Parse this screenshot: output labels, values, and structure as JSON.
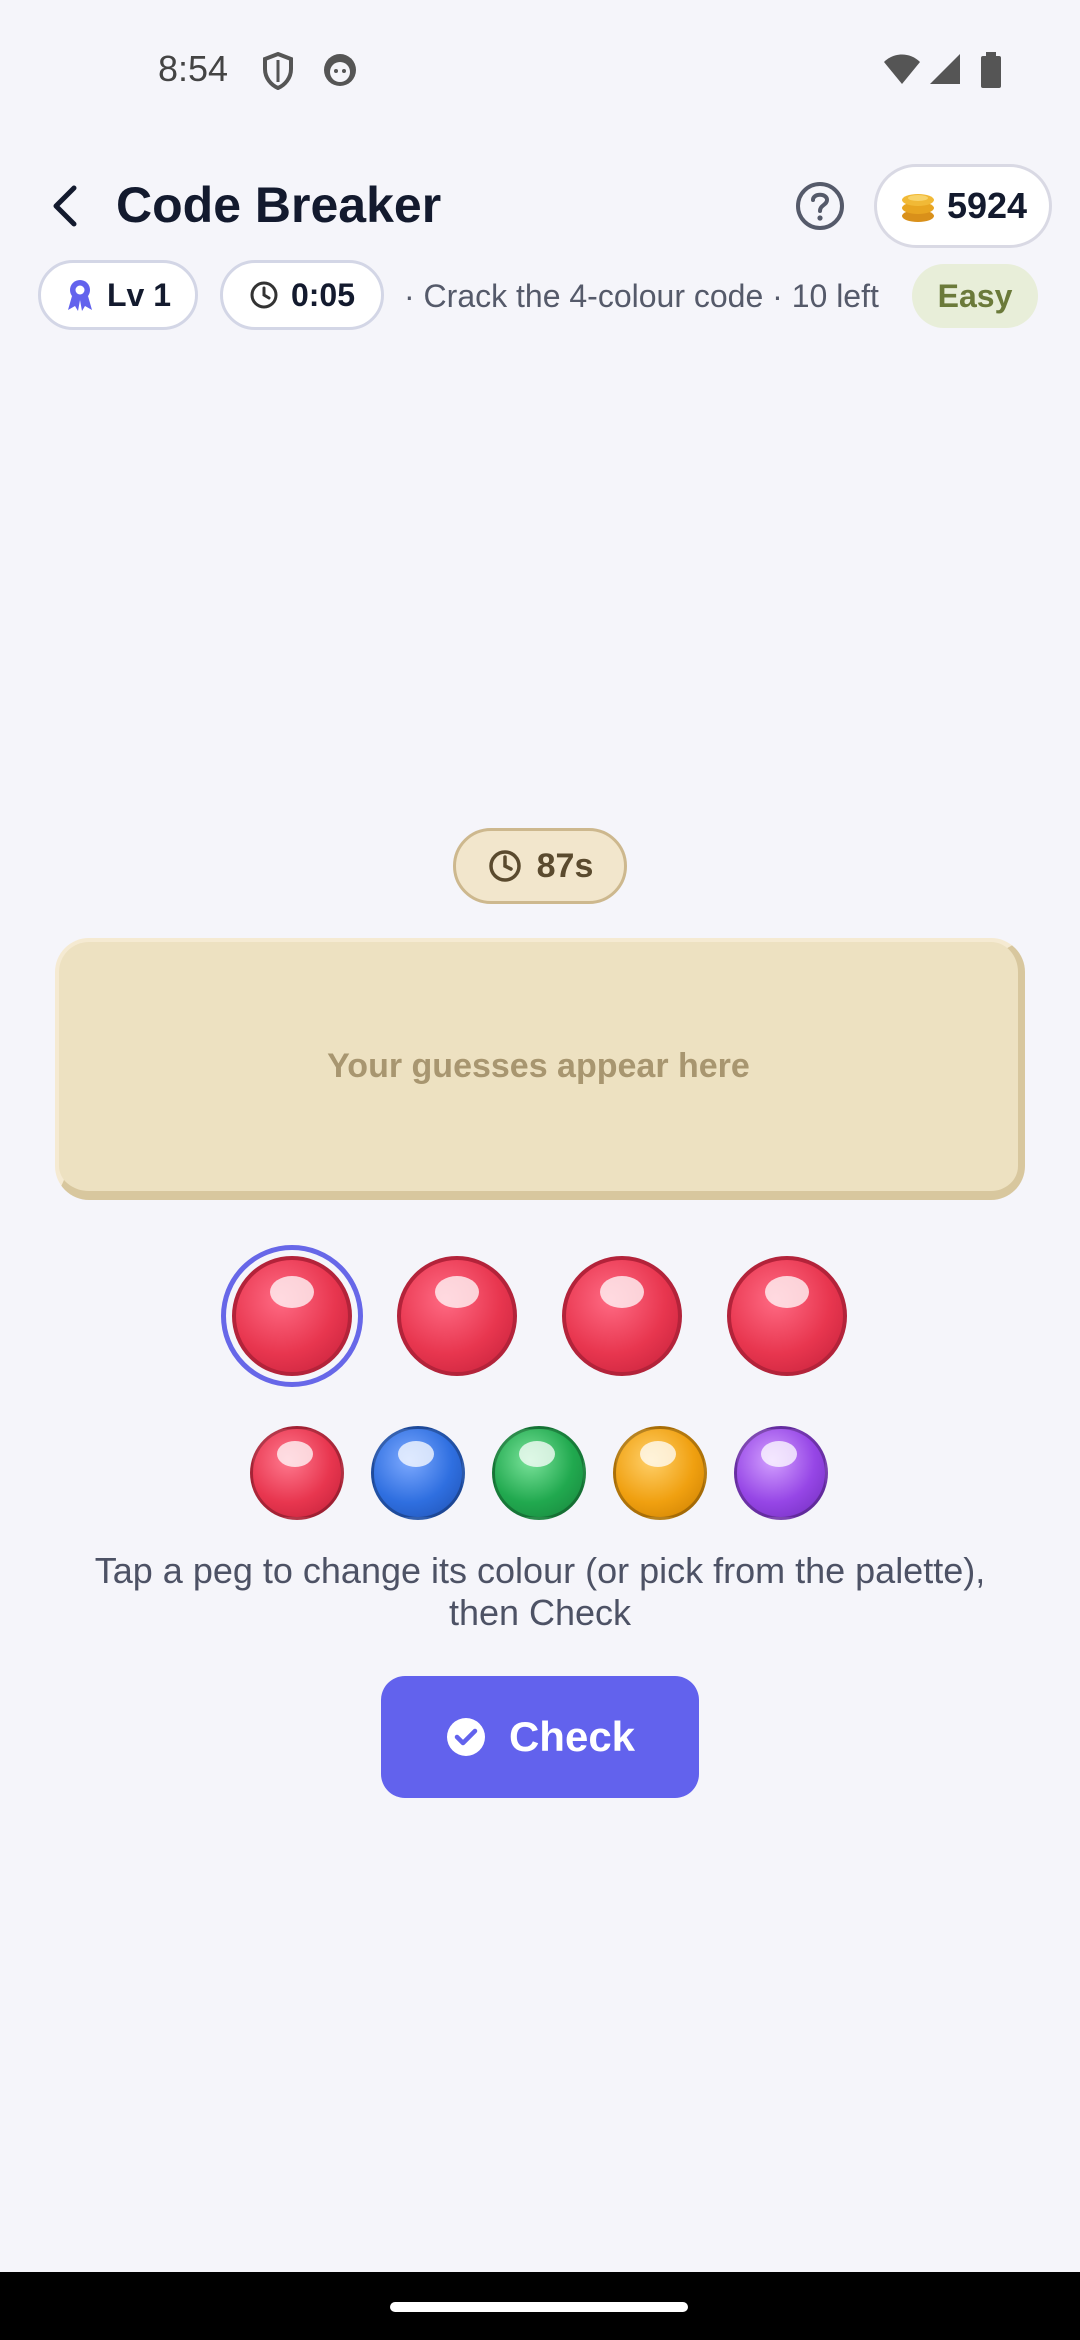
{
  "status": {
    "time": "8:54",
    "icons": [
      "shield-icon",
      "face-icon",
      "wifi-icon",
      "signal-icon",
      "battery-icon"
    ]
  },
  "header": {
    "title": "Code Breaker",
    "coins": "5924"
  },
  "chips": {
    "level": "Lv 1",
    "elapsed": "0:05",
    "info": "· Crack the 4-colour code · 10 left",
    "difficulty": "Easy"
  },
  "timer": "87s",
  "board": {
    "placeholder": "Your guesses appear here"
  },
  "guess_slots": [
    {
      "color": "red",
      "selected": true
    },
    {
      "color": "red",
      "selected": false
    },
    {
      "color": "red",
      "selected": false
    },
    {
      "color": "red",
      "selected": false
    }
  ],
  "palette": [
    {
      "color": "red",
      "hex": "#e8364f"
    },
    {
      "color": "blue",
      "hex": "#2f6fe0"
    },
    {
      "color": "green",
      "hex": "#21a94f"
    },
    {
      "color": "orange",
      "hex": "#f0a010"
    },
    {
      "color": "purple",
      "hex": "#9646e6"
    }
  ],
  "hint": "Tap a peg to change its colour (or pick from the palette), then Check",
  "check_label": "Check",
  "colors": {
    "accent": "#6262ed",
    "board": "#ede1c1",
    "easy_bg": "#e8eed9"
  }
}
